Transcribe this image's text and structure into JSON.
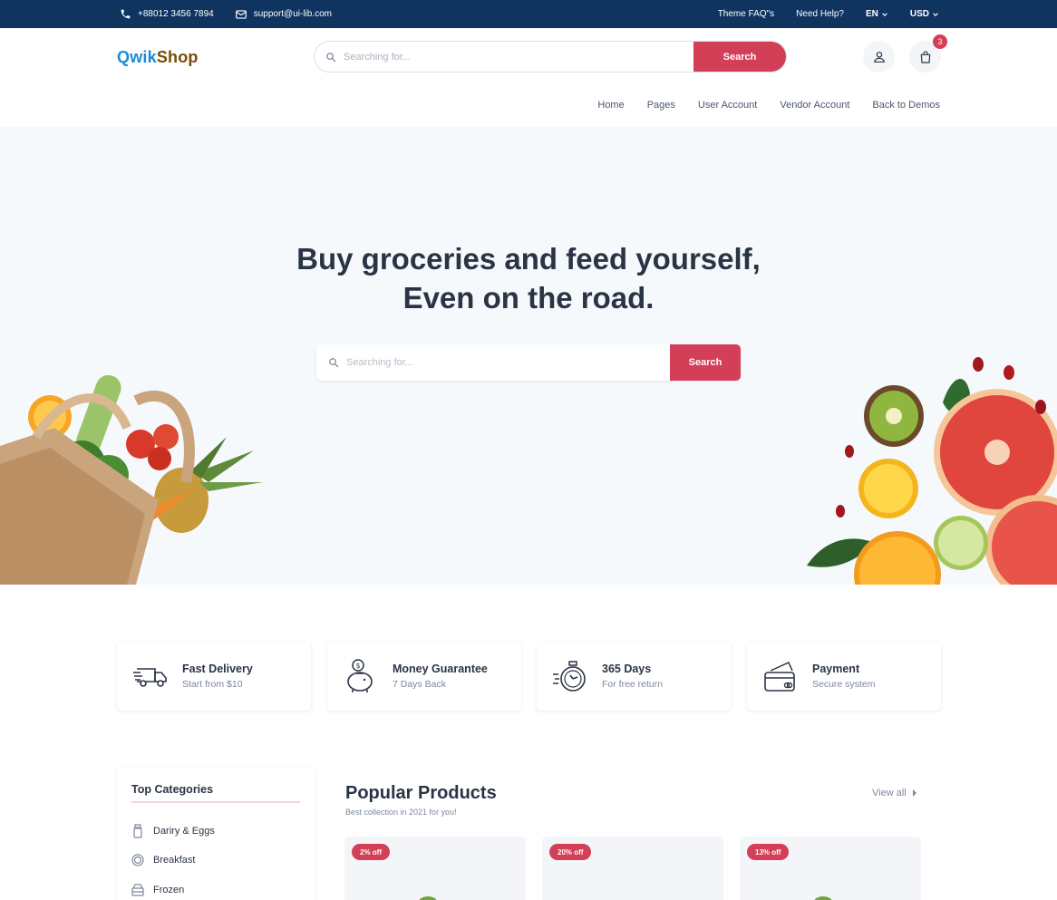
{
  "topbar": {
    "phone": "+88012 3456 7894",
    "email": "support@ui-lib.com",
    "faq": "Theme FAQ\"s",
    "help": "Need Help?",
    "language": "EN",
    "currency": "USD"
  },
  "header": {
    "logo_part1": "Qwik",
    "logo_part2": "Shop",
    "search_placeholder": "Searching for...",
    "search_button": "Search",
    "cart_count": "3"
  },
  "nav": {
    "items": [
      {
        "label": "Home"
      },
      {
        "label": "Pages"
      },
      {
        "label": "User Account"
      },
      {
        "label": "Vendor Account"
      },
      {
        "label": "Back to Demos"
      }
    ]
  },
  "hero": {
    "line1": "Buy groceries and feed yourself,",
    "line2": "Even on the road.",
    "search_placeholder": "Searching for...",
    "search_button": "Search"
  },
  "services": [
    {
      "title": "Fast Delivery",
      "subtitle": "Start from $10",
      "icon": "truck-icon"
    },
    {
      "title": "Money Guarantee",
      "subtitle": "7 Days Back",
      "icon": "piggy-bank-icon"
    },
    {
      "title": "365 Days",
      "subtitle": "For free return",
      "icon": "stopwatch-icon"
    },
    {
      "title": "Payment",
      "subtitle": "Secure system",
      "icon": "credit-card-icon"
    }
  ],
  "sidebar": {
    "title": "Top Categories",
    "items": [
      {
        "label": "Dariry & Eggs",
        "icon": "milk-bottle-icon"
      },
      {
        "label": "Breakfast",
        "icon": "plate-icon"
      },
      {
        "label": "Frozen",
        "icon": "frozen-box-icon"
      }
    ]
  },
  "popular": {
    "title": "Popular Products",
    "subtitle": "Best collection in 2021 for you!",
    "view_all": "View all",
    "products": [
      {
        "discount": "2% off"
      },
      {
        "discount": "20% off"
      },
      {
        "discount": "13% off"
      }
    ]
  },
  "colors": {
    "primary_dark": "#0f3460",
    "accent": "#d23f57",
    "text": "#2b3445",
    "muted": "#7d879c",
    "hero_bg": "#f6f9fc"
  }
}
